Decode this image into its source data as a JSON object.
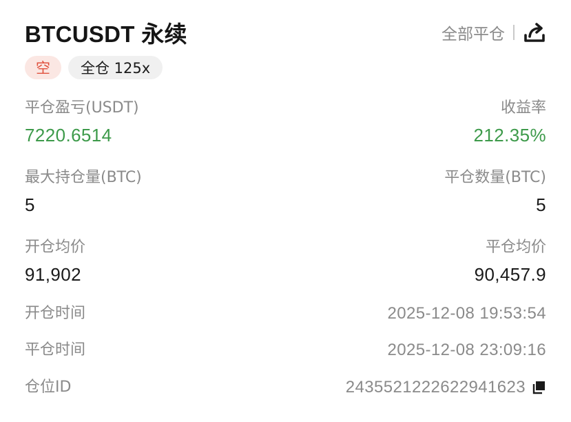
{
  "header": {
    "title": "BTCUSDT 永续",
    "close_all_label": "全部平仓",
    "share_icon": "share-icon"
  },
  "tags": {
    "side": "空",
    "margin_mode": "全仓 125x"
  },
  "pnl": {
    "label": "平仓盈亏(USDT)",
    "value": "7220.6514"
  },
  "roi": {
    "label": "收益率",
    "value": "212.35%"
  },
  "max_position": {
    "label": "最大持仓量(BTC)",
    "value": "5"
  },
  "close_qty": {
    "label": "平仓数量(BTC)",
    "value": "5"
  },
  "open_price": {
    "label": "开仓均价",
    "value": "91,902"
  },
  "close_price": {
    "label": "平仓均价",
    "value": "90,457.9"
  },
  "open_time": {
    "label": "开仓时间",
    "value": "2025-12-08 19:53:54"
  },
  "close_time": {
    "label": "平仓时间",
    "value": "2025-12-08 23:09:16"
  },
  "position_id": {
    "label": "仓位ID",
    "value": "2435521222622941623",
    "copy_icon": "copy-icon"
  },
  "colors": {
    "profit_green": "#3d9a4a",
    "short_red": "#e0523f",
    "short_bg": "#fbe7e3",
    "label_gray": "#8a8a8a"
  }
}
